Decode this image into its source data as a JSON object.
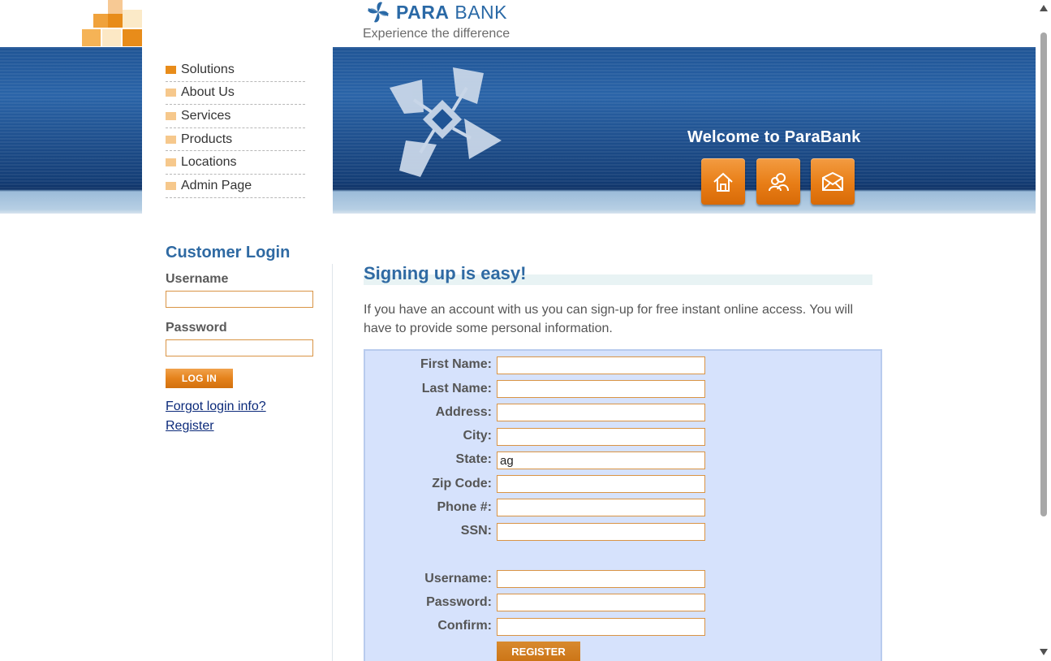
{
  "brand": {
    "name_bold": "PARA",
    "name_regular": " BANK",
    "tagline": "Experience the difference"
  },
  "nav": {
    "items": [
      {
        "label": "Solutions",
        "active": true
      },
      {
        "label": "About Us"
      },
      {
        "label": "Services"
      },
      {
        "label": "Products"
      },
      {
        "label": "Locations"
      },
      {
        "label": "Admin Page"
      }
    ]
  },
  "header": {
    "welcome": "Welcome to ParaBank",
    "buttons": [
      {
        "icon": "home-icon"
      },
      {
        "icon": "about-people-icon"
      },
      {
        "icon": "contact-envelope-icon"
      }
    ]
  },
  "login": {
    "title": "Customer Login",
    "username_label": "Username",
    "username_value": "",
    "password_label": "Password",
    "password_value": "",
    "button": "LOG IN",
    "forgot_link": "Forgot login info?",
    "register_link": "Register"
  },
  "main": {
    "title": "Signing up is easy!",
    "intro": "If you have an account with us you can sign-up for free instant online access. You will have to provide some personal information."
  },
  "form": {
    "fields": [
      {
        "label": "First Name:",
        "value": ""
      },
      {
        "label": "Last Name:",
        "value": ""
      },
      {
        "label": "Address:",
        "value": ""
      },
      {
        "label": "City:",
        "value": ""
      },
      {
        "label": "State:",
        "value": "ag"
      },
      {
        "label": "Zip Code:",
        "value": ""
      },
      {
        "label": "Phone #:",
        "value": ""
      },
      {
        "label": "SSN:",
        "value": ""
      },
      {
        "label": "Username:",
        "value": ""
      },
      {
        "label": "Password:",
        "value": ""
      },
      {
        "label": "Confirm:",
        "value": ""
      }
    ],
    "submit": "REGISTER"
  },
  "colors": {
    "accent_orange": "#e88c1a",
    "title_blue": "#2f6aa3",
    "header_blue": "#1f5495",
    "form_bg": "#d6e2fc"
  }
}
